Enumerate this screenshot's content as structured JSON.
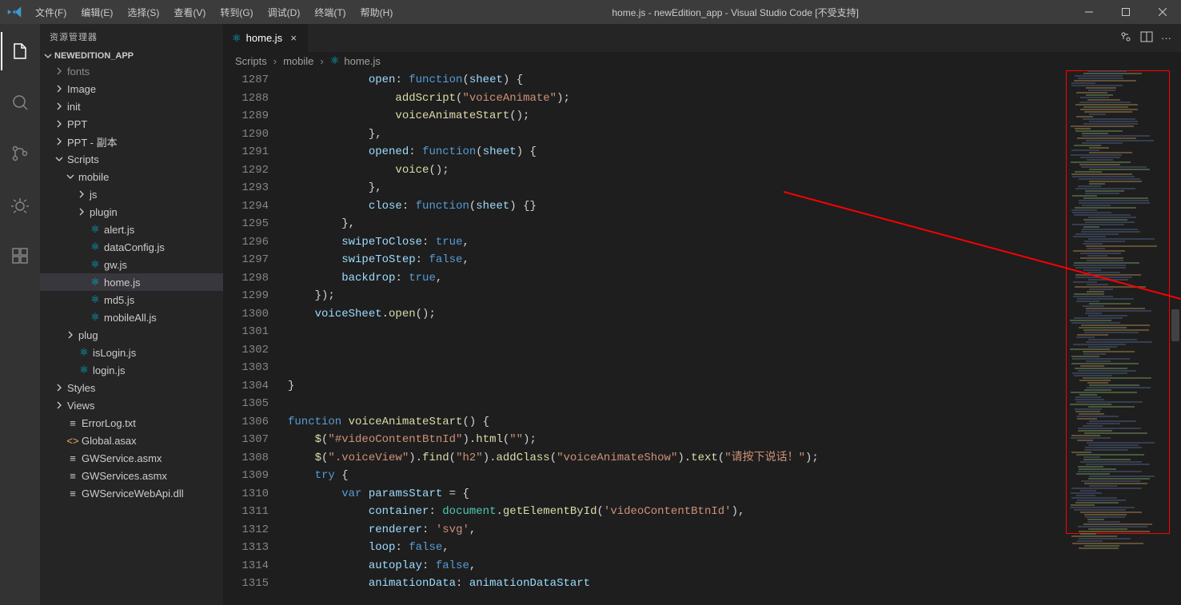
{
  "titlebar": {
    "title": "home.js - newEdition_app - Visual Studio Code [不受支持]",
    "menu": [
      "文件(F)",
      "编辑(E)",
      "选择(S)",
      "查看(V)",
      "转到(G)",
      "调试(D)",
      "终端(T)",
      "帮助(H)"
    ]
  },
  "sidebar": {
    "title": "资源管理器",
    "root": "NEWEDITION_APP",
    "tree": [
      {
        "label": "fonts",
        "kind": "folder",
        "indent": 1,
        "expanded": false,
        "dim": true
      },
      {
        "label": "Image",
        "kind": "folder",
        "indent": 1,
        "expanded": false
      },
      {
        "label": "init",
        "kind": "folder",
        "indent": 1,
        "expanded": false
      },
      {
        "label": "PPT",
        "kind": "folder",
        "indent": 1,
        "expanded": false
      },
      {
        "label": "PPT - 副本",
        "kind": "folder",
        "indent": 1,
        "expanded": false
      },
      {
        "label": "Scripts",
        "kind": "folder",
        "indent": 1,
        "expanded": true
      },
      {
        "label": "mobile",
        "kind": "folder",
        "indent": 2,
        "expanded": true
      },
      {
        "label": "js",
        "kind": "folder",
        "indent": 3,
        "expanded": false
      },
      {
        "label": "plugin",
        "kind": "folder",
        "indent": 3,
        "expanded": false
      },
      {
        "label": "alert.js",
        "kind": "react",
        "indent": 3
      },
      {
        "label": "dataConfig.js",
        "kind": "react",
        "indent": 3
      },
      {
        "label": "gw.js",
        "kind": "react",
        "indent": 3
      },
      {
        "label": "home.js",
        "kind": "react",
        "indent": 3,
        "selected": true
      },
      {
        "label": "md5.js",
        "kind": "react",
        "indent": 3
      },
      {
        "label": "mobileAll.js",
        "kind": "react",
        "indent": 3
      },
      {
        "label": "plug",
        "kind": "folder",
        "indent": 2,
        "expanded": false
      },
      {
        "label": "isLogin.js",
        "kind": "react",
        "indent": 2
      },
      {
        "label": "login.js",
        "kind": "react",
        "indent": 2
      },
      {
        "label": "Styles",
        "kind": "folder",
        "indent": 1,
        "expanded": false
      },
      {
        "label": "Views",
        "kind": "folder",
        "indent": 1,
        "expanded": false
      },
      {
        "label": "ErrorLog.txt",
        "kind": "file",
        "indent": 1
      },
      {
        "label": "Global.asax",
        "kind": "code",
        "indent": 1
      },
      {
        "label": "GWService.asmx",
        "kind": "file",
        "indent": 1
      },
      {
        "label": "GWServices.asmx",
        "kind": "file",
        "indent": 1
      },
      {
        "label": "GWServiceWebApi.dll",
        "kind": "file",
        "indent": 1
      }
    ]
  },
  "tab": {
    "label": "home.js"
  },
  "breadcrumbs": {
    "p0": "Scripts",
    "p1": "mobile",
    "p2": "home.js"
  },
  "gutter": {
    "start": 1287,
    "end": 1315
  },
  "code_lines": [
    "            <span class='tok-prop'>open</span>: <span class='tok-kw'>function</span>(<span class='tok-param'>sheet</span>) {",
    "                <span class='tok-fn'>addScript</span>(<span class='tok-str'>\"voiceAnimate\"</span>);",
    "                <span class='tok-fn'>voiceAnimateStart</span>();",
    "            },",
    "            <span class='tok-prop'>opened</span>: <span class='tok-kw'>function</span>(<span class='tok-param'>sheet</span>) {",
    "                <span class='tok-fn'>voice</span>();",
    "            },",
    "            <span class='tok-prop'>close</span>: <span class='tok-kw'>function</span>(<span class='tok-param'>sheet</span>) {}",
    "        },",
    "        <span class='tok-prop'>swipeToClose</span>: <span class='tok-bool'>true</span>,",
    "        <span class='tok-prop'>swipeToStep</span>: <span class='tok-bool'>false</span>,",
    "        <span class='tok-prop'>backdrop</span>: <span class='tok-bool'>true</span>,",
    "    });",
    "    <span class='tok-var'>voiceSheet</span>.<span class='tok-fn'>open</span>();",
    "",
    "",
    "",
    "}",
    "",
    "<span class='tok-kw'>function</span> <span class='tok-fn'>voiceAnimateStart</span>() {",
    "    <span class='tok-fn'>$</span>(<span class='tok-str'>\"#videoContentBtnId\"</span>).<span class='tok-fn'>html</span>(<span class='tok-str'>\"\"</span>);",
    "    <span class='tok-fn'>$</span>(<span class='tok-str'>\".voiceView\"</span>).<span class='tok-fn'>find</span>(<span class='tok-str'>\"h2\"</span>).<span class='tok-fn'>addClass</span>(<span class='tok-str'>\"voiceAnimateShow\"</span>).<span class='tok-fn'>text</span>(<span class='tok-str'>\"请按下说话！\"</span>);",
    "    <span class='tok-kw'>try</span> {",
    "        <span class='tok-kw'>var</span> <span class='tok-var'>paramsStart</span> = {",
    "            <span class='tok-prop'>container</span>: <span class='tok-obj'>document</span>.<span class='tok-fn'>getElementById</span>(<span class='tok-str'>'videoContentBtnId'</span>),",
    "            <span class='tok-prop'>renderer</span>: <span class='tok-str'>'svg'</span>,",
    "            <span class='tok-prop'>loop</span>: <span class='tok-bool'>false</span>,",
    "            <span class='tok-prop'>autoplay</span>: <span class='tok-bool'>false</span>,",
    "            <span class='tok-prop'>animationData</span>: <span class='tok-var'>animationDataStart</span>"
  ]
}
